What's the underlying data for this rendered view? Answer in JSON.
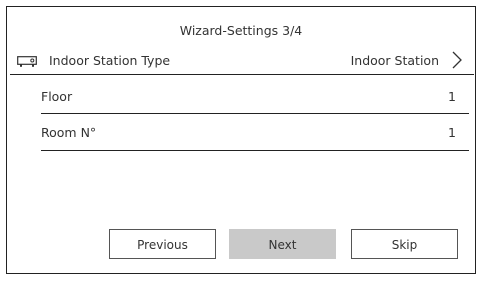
{
  "header": {
    "title": "Wizard-Settings 3/4"
  },
  "settings": {
    "station_type": {
      "icon": "indoor-station-device-icon",
      "label": "Indoor Station Type",
      "value": "Indoor Station",
      "chevron_icon": "chevron-right-icon"
    },
    "floor": {
      "label": "Floor",
      "value": "1"
    },
    "room": {
      "label": "Room N°",
      "value": "1"
    }
  },
  "buttons": {
    "previous": "Previous",
    "next": "Next",
    "skip": "Skip"
  },
  "colors": {
    "next_button_bg": "#c9c9c9",
    "border": "#222222",
    "text": "#333333"
  }
}
